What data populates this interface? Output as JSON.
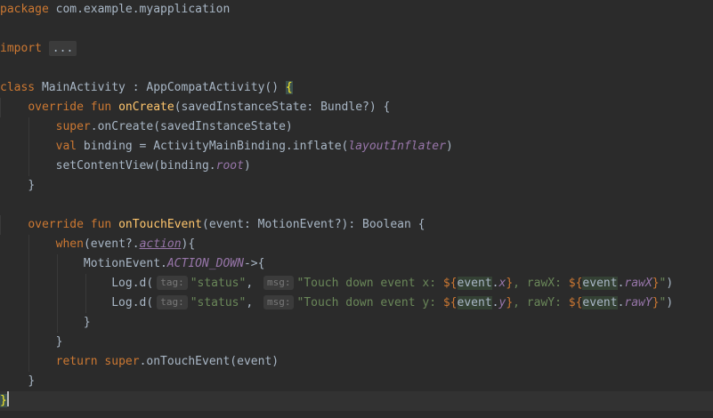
{
  "code": {
    "package_kw": "package",
    "package_name": " com.example.myapplication",
    "import_kw": "import",
    "import_fold": "...",
    "class_kw": "class",
    "class_decl": " MainActivity : AppCompatActivity() ",
    "open_brace": "{",
    "oncreate": {
      "override_kw": "override",
      "fun_kw": "fun",
      "name": "onCreate",
      "params": "(savedInstanceState: Bundle?) {"
    },
    "super_kw": "super",
    "super_call": ".onCreate(savedInstanceState)",
    "val_kw": "val",
    "binding_decl": " binding = ActivityMainBinding.inflate(",
    "layout_inflater": "layoutInflater",
    "close_paren": ")",
    "set_content": "setContentView(binding.",
    "root_prop": "root",
    "close_brace": "}",
    "ontouch": {
      "override_kw": "override",
      "fun_kw": "fun",
      "name": "onTouchEvent",
      "params": "(event: MotionEvent?): Boolean {"
    },
    "when_kw": "when",
    "when_open": "(event?.",
    "action_prop": "action",
    "when_close": "){",
    "motion_event": "MotionEvent.",
    "action_down": "ACTION_DOWN",
    "arrow": "->{",
    "log_call": "Log.d(",
    "tag_hint": "tag:",
    "status_str": "\"status\"",
    "comma": ", ",
    "msg_hint": "msg:",
    "msg_x_prefix": "\"Touch down event x: ",
    "msg_y_prefix": "\"Touch down event y: ",
    "tmpl_open": "${",
    "event_word": "event",
    "dot": ".",
    "prop_x": "x",
    "prop_y": "y",
    "tmpl_close": "}",
    "raw_x_text": ", rawX: ",
    "raw_y_text": ", rawY: ",
    "prop_rawx": "rawX",
    "prop_rawy": "rawY",
    "str_end": "\"",
    "return_kw": "return",
    "return_rest": ".onTouchEvent(event)"
  }
}
